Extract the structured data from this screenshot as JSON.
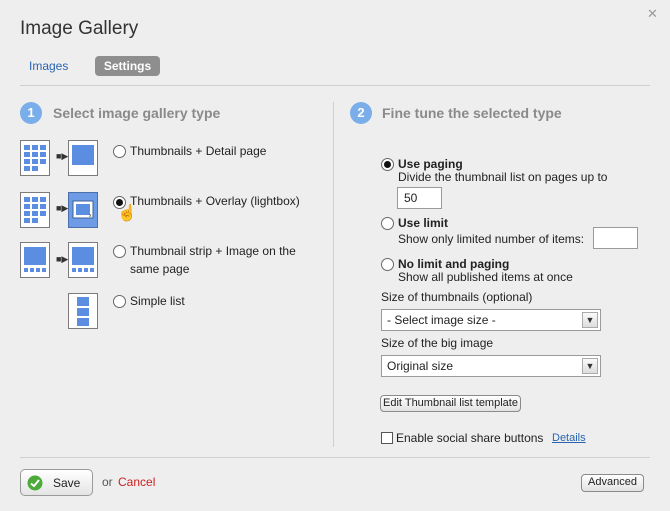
{
  "dialog": {
    "title": "Image Gallery"
  },
  "tabs": [
    {
      "label": "Images"
    },
    {
      "label": "Settings"
    }
  ],
  "left": {
    "step": "1",
    "title": "Select image gallery type",
    "options": [
      {
        "label": "Thumbnails + Detail page",
        "selected": false
      },
      {
        "label": "Thumbnails + Overlay (lightbox)",
        "selected": true
      },
      {
        "label_line1": "Thumbnail strip + Image on the",
        "label_line2": "same page",
        "selected": false
      },
      {
        "label": "Simple list",
        "selected": false
      }
    ]
  },
  "right": {
    "step": "2",
    "title": "Fine tune the selected type",
    "paging": {
      "label": "Use paging",
      "desc": "Divide the thumbnail list on pages up to",
      "value": "50",
      "selected": true
    },
    "limit": {
      "label": "Use limit",
      "desc": "Show only limited number of items:",
      "value": "",
      "selected": false
    },
    "nolimit": {
      "label": "No limit and paging",
      "desc": "Show all published items at once",
      "selected": false
    },
    "thumb_size": {
      "label": "Size of thumbnails (optional)",
      "value": "- Select image size -"
    },
    "big_size": {
      "label": "Size of the big image",
      "value": "Original size"
    },
    "edit_template": "Edit Thumbnail list template",
    "social": {
      "label": "Enable social share buttons",
      "details": "Details",
      "checked": false
    }
  },
  "footer": {
    "save": "Save",
    "or": "or",
    "cancel": "Cancel",
    "advanced": "Advanced"
  },
  "colors": {
    "accent": "#7aaeea",
    "link": "#2a64b0",
    "cancel": "#cc1f1f",
    "icon_blue": "#6d9be5"
  }
}
